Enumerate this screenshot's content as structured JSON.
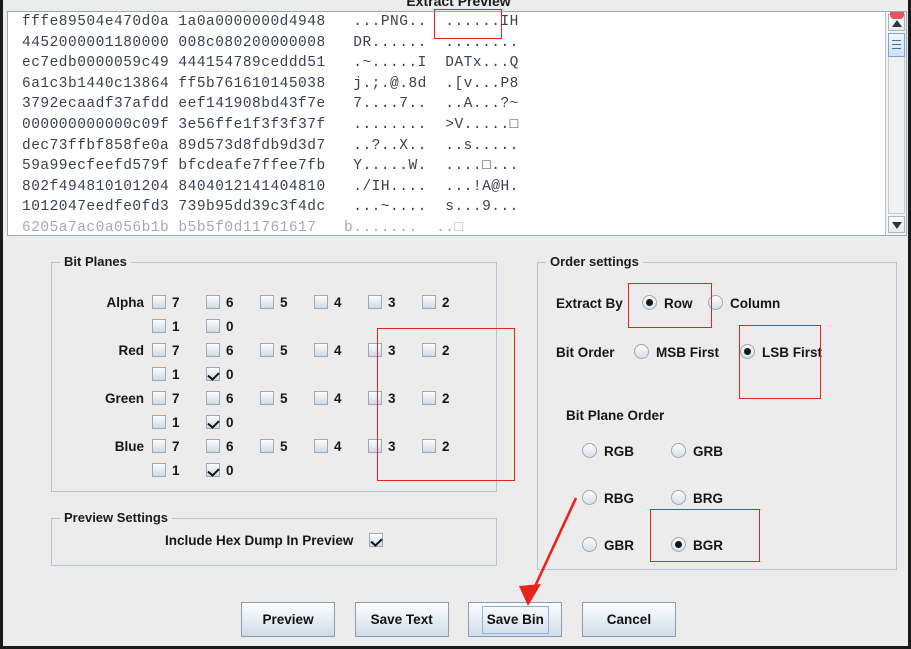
{
  "window": {
    "title": "Extract Preview"
  },
  "hex_dump": {
    "lines": [
      {
        "hex1": "fffe89504e470d0a",
        "hex2": "1a0a0000000d4948",
        "ascii": "...PNG..  ......IH"
      },
      {
        "hex1": "4452000001180000",
        "hex2": "008c080200000008",
        "ascii": "DR......  ........"
      },
      {
        "hex1": "ec7edb0000059c49",
        "hex2": "444154789ceddd51",
        "ascii": ".~.....I  DATx...Q"
      },
      {
        "hex1": "6a1c3b1440c13864",
        "hex2": "ff5b761610145038",
        "ascii": "j.;.@.8d  .[v...P8"
      },
      {
        "hex1": "3792ecaadf37afdd",
        "hex2": "eef141908bd43f7e",
        "ascii": "7....7..  ..A...?~"
      },
      {
        "hex1": "000000000000c09f",
        "hex2": "3e56ffe1f3f3f37f",
        "ascii": "........  >V.....□"
      },
      {
        "hex1": "dec73ffbf858fe0a",
        "hex2": "89d573d8fdb9d3d7",
        "ascii": "..?..X..  ..s....."
      },
      {
        "hex1": "59a99ecfeefd579f",
        "hex2": "bfcdeafe7ffee7fb",
        "ascii": "Y.....W.  ....□..."
      },
      {
        "hex1": "802f494810101204",
        "hex2": "8404012141404810",
        "ascii": "./IH....  ...!A@H."
      },
      {
        "hex1": "1012047eedfe0fd3",
        "hex2": "739b95dd39c3f4dc",
        "ascii": "...~....  s...9..."
      },
      {
        "hex1": "6205a7ac0a056b1b",
        "hex2": "b5b5f0d11761617",
        "ascii": "b.......  ..□"
      }
    ]
  },
  "scrollbar": {
    "up_icon": "triangle-up-icon",
    "down_icon": "triangle-down-icon"
  },
  "bit_planes": {
    "legend": "Bit Planes",
    "bit_labels": [
      "7",
      "6",
      "5",
      "4",
      "3",
      "2",
      "1",
      "0"
    ],
    "rows": [
      {
        "name": "Alpha",
        "checked": [
          false,
          false,
          false,
          false,
          false,
          false,
          false,
          false
        ]
      },
      {
        "name": "Red",
        "checked": [
          false,
          false,
          false,
          false,
          false,
          false,
          false,
          true
        ]
      },
      {
        "name": "Green",
        "checked": [
          false,
          false,
          false,
          false,
          false,
          false,
          false,
          true
        ]
      },
      {
        "name": "Blue",
        "checked": [
          false,
          false,
          false,
          false,
          false,
          false,
          false,
          true
        ]
      }
    ]
  },
  "preview_settings": {
    "legend": "Preview Settings",
    "include_hex_dump_label": "Include Hex Dump In Preview",
    "include_hex_dump_checked": true
  },
  "order_settings": {
    "legend": "Order settings",
    "extract_by_label": "Extract By",
    "extract_by_options": [
      "Row",
      "Column"
    ],
    "extract_by_selected": "Row",
    "bit_order_label": "Bit Order",
    "bit_order_options": [
      "MSB First",
      "LSB First"
    ],
    "bit_order_selected": "LSB First",
    "bit_plane_order_label": "Bit Plane Order",
    "bit_plane_order_options": [
      "RGB",
      "GRB",
      "RBG",
      "BRG",
      "GBR",
      "BGR"
    ],
    "bit_plane_order_selected": "BGR"
  },
  "buttons": {
    "preview": "Preview",
    "save_text": "Save Text",
    "save_bin": "Save Bin",
    "cancel": "Cancel"
  },
  "annotations": {
    "accent_color": "#e8231c",
    "highlight_png": "PNG signature highlight",
    "highlight_bit0": "Bit plane 0 column highlight",
    "highlight_row": "Extract By Row highlight",
    "highlight_lsb": "LSB First highlight",
    "highlight_bgr": "BGR highlight",
    "arrow_to_save_bin": "arrow pointing to Save Bin"
  }
}
